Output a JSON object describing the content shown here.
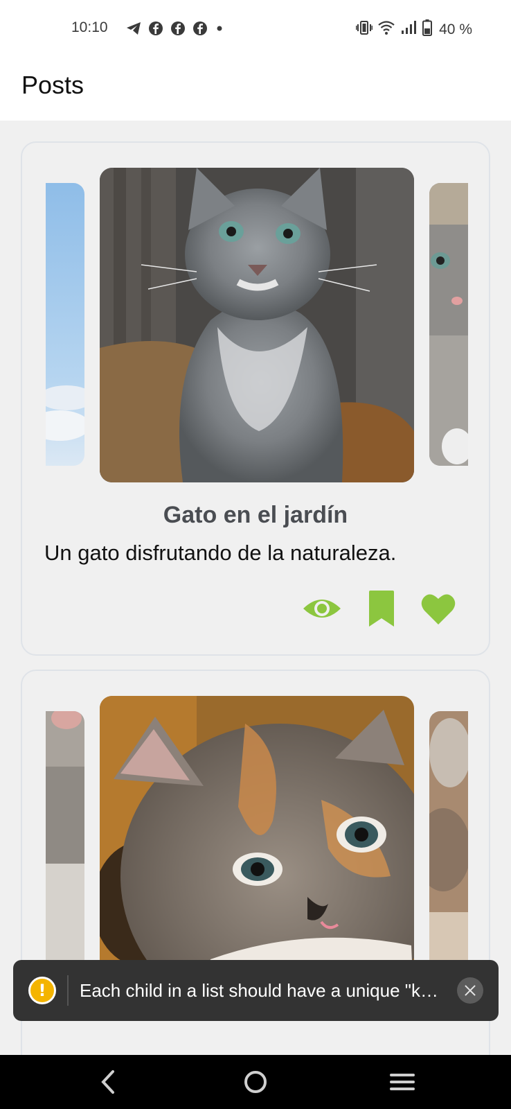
{
  "status_bar": {
    "time": "10:10",
    "battery_text": "40 %",
    "notification_icons": [
      "telegram-icon",
      "facebook-icon",
      "facebook-icon",
      "facebook-icon",
      "more-dot-icon"
    ],
    "system_icons": [
      "vibrate-icon",
      "wifi-icon",
      "signal-icon",
      "battery-icon"
    ]
  },
  "header": {
    "title": "Posts"
  },
  "posts": [
    {
      "title": "Gato en el jardín",
      "description": "Un gato disfrutando de la naturaleza.",
      "actions": [
        "eye-icon",
        "bookmark-icon",
        "heart-icon"
      ]
    },
    {
      "title": "",
      "description": ""
    }
  ],
  "toast": {
    "message": "Each child in a list should have a unique \"key\" prop."
  },
  "navigation": [
    "back-icon",
    "home-icon",
    "recents-icon"
  ],
  "colors": {
    "accent": "#8cc63f",
    "title_text": "#4a4d52",
    "toast_bg": "#333333",
    "warning": "#f4b400"
  }
}
